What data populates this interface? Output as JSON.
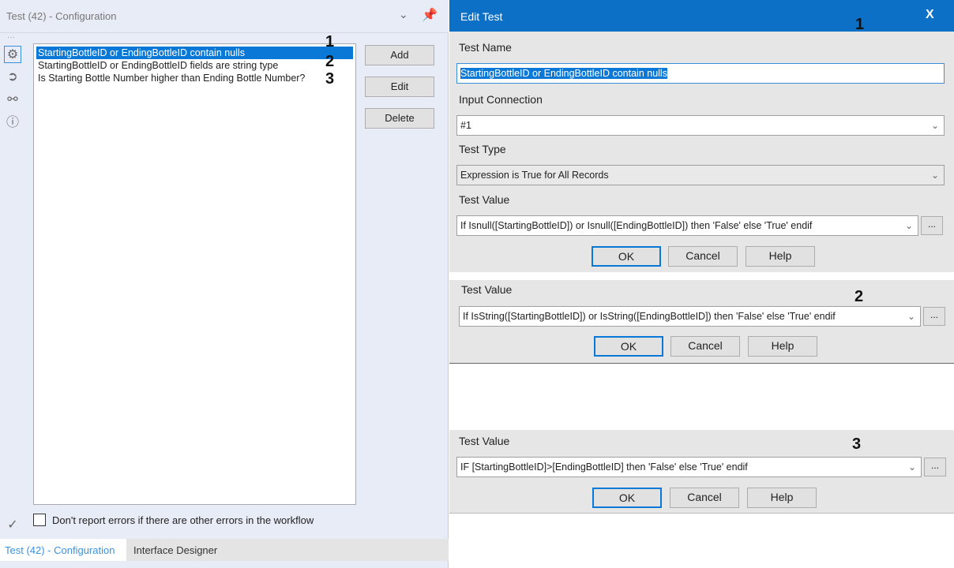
{
  "left_panel": {
    "title": "Test (42) - Configuration",
    "tests": [
      "StartingBottleID or EndingBottleID contain nulls",
      "StartingBottleID or EndingBottleID fields are string type",
      "Is Starting Bottle Number higher than Ending Bottle Number?"
    ],
    "annotations": [
      "1",
      "2",
      "3"
    ],
    "buttons": {
      "add": "Add",
      "edit": "Edit",
      "delete": "Delete"
    },
    "checkbox_label": "Don't report errors if there are other errors in the workflow",
    "checkbox_checked": false,
    "tabs": [
      "Test (42) - Configuration",
      "Interface Designer"
    ]
  },
  "dialog": {
    "title": "Edit Test",
    "close": "X",
    "annotation": "1",
    "test_name_label": "Test Name",
    "test_name_value": "StartingBottleID or EndingBottleID contain nulls",
    "input_connection_label": "Input Connection",
    "input_connection_value": "#1",
    "test_type_label": "Test Type",
    "test_type_value": "Expression is True for All Records",
    "test_value_label": "Test Value",
    "ellipsis": "...",
    "ok": "OK",
    "cancel": "Cancel",
    "help": "Help",
    "sections": [
      {
        "annotation": "1",
        "value": "If Isnull([StartingBottleID]) or Isnull([EndingBottleID]) then 'False' else 'True' endif"
      },
      {
        "annotation": "2",
        "value": "If IsString([StartingBottleID]) or IsString([EndingBottleID]) then 'False' else 'True' endif"
      },
      {
        "annotation": "3",
        "value": "IF [StartingBottleID]>[EndingBottleID] then 'False' else 'True' endif"
      }
    ]
  }
}
